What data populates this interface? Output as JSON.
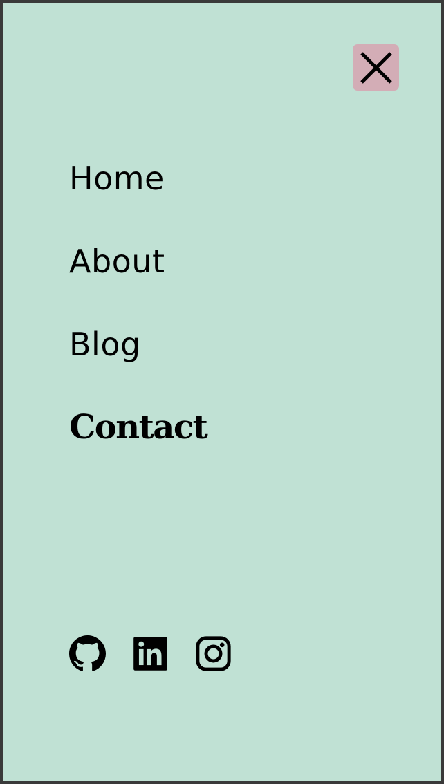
{
  "menu": {
    "close_icon": "close-icon",
    "items": [
      {
        "label": "Home",
        "active": false
      },
      {
        "label": "About",
        "active": false
      },
      {
        "label": "Blog",
        "active": false
      },
      {
        "label": "Contact",
        "active": true
      }
    ]
  },
  "social": [
    {
      "icon": "github-icon"
    },
    {
      "icon": "linkedin-icon"
    },
    {
      "icon": "instagram-icon"
    }
  ],
  "colors": {
    "panel_background": "#c0e1d4",
    "close_button_background": "#d3adb6",
    "frame_border": "#3a3a3a",
    "text": "#000000"
  }
}
